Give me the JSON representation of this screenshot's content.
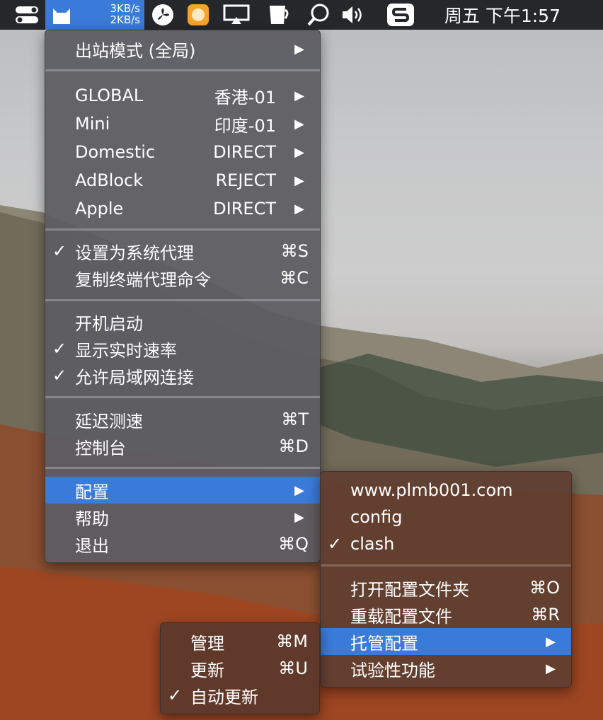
{
  "menubar": {
    "speed_up": "3KB/s",
    "speed_down": "2KB/s",
    "clock": "周五 下午1:57"
  },
  "main_menu": {
    "outbound_mode": "出站模式 (全局)",
    "proxies": [
      {
        "name": "GLOBAL",
        "value": "香港-01"
      },
      {
        "name": "Mini",
        "value": "印度-01"
      },
      {
        "name": "Domestic",
        "value": "DIRECT"
      },
      {
        "name": "AdBlock",
        "value": "REJECT"
      },
      {
        "name": "Apple",
        "value": "DIRECT"
      }
    ],
    "set_system_proxy": {
      "label": "设置为系统代理",
      "shortcut": "⌘S",
      "checked": "✓"
    },
    "copy_terminal": {
      "label": "复制终端代理命令",
      "shortcut": "⌘C"
    },
    "launch_at_login": {
      "label": "开机启动"
    },
    "show_speed": {
      "label": "显示实时速率",
      "checked": "✓"
    },
    "allow_lan": {
      "label": "允许局域网连接",
      "checked": "✓"
    },
    "latency_test": {
      "label": "延迟测速",
      "shortcut": "⌘T"
    },
    "dashboard": {
      "label": "控制台",
      "shortcut": "⌘D"
    },
    "config": {
      "label": "配置"
    },
    "help": {
      "label": "帮助"
    },
    "quit": {
      "label": "退出",
      "shortcut": "⌘Q"
    }
  },
  "config_menu": {
    "profiles": [
      {
        "label": "www.plmb001.com",
        "checked": ""
      },
      {
        "label": "config",
        "checked": ""
      },
      {
        "label": "clash",
        "checked": "✓"
      }
    ],
    "open_folder": {
      "label": "打开配置文件夹",
      "shortcut": "⌘O"
    },
    "reload": {
      "label": "重载配置文件",
      "shortcut": "⌘R"
    },
    "managed": {
      "label": "托管配置"
    },
    "experimental": {
      "label": "试验性功能"
    }
  },
  "managed_menu": {
    "manage": {
      "label": "管理",
      "shortcut": "⌘M"
    },
    "update": {
      "label": "更新",
      "shortcut": "⌘U"
    },
    "auto_update": {
      "label": "自动更新",
      "checked": "✓"
    }
  },
  "arrow": "▶",
  "colors": {
    "highlight": "#3a7ad8",
    "menubar": "#26272b"
  }
}
